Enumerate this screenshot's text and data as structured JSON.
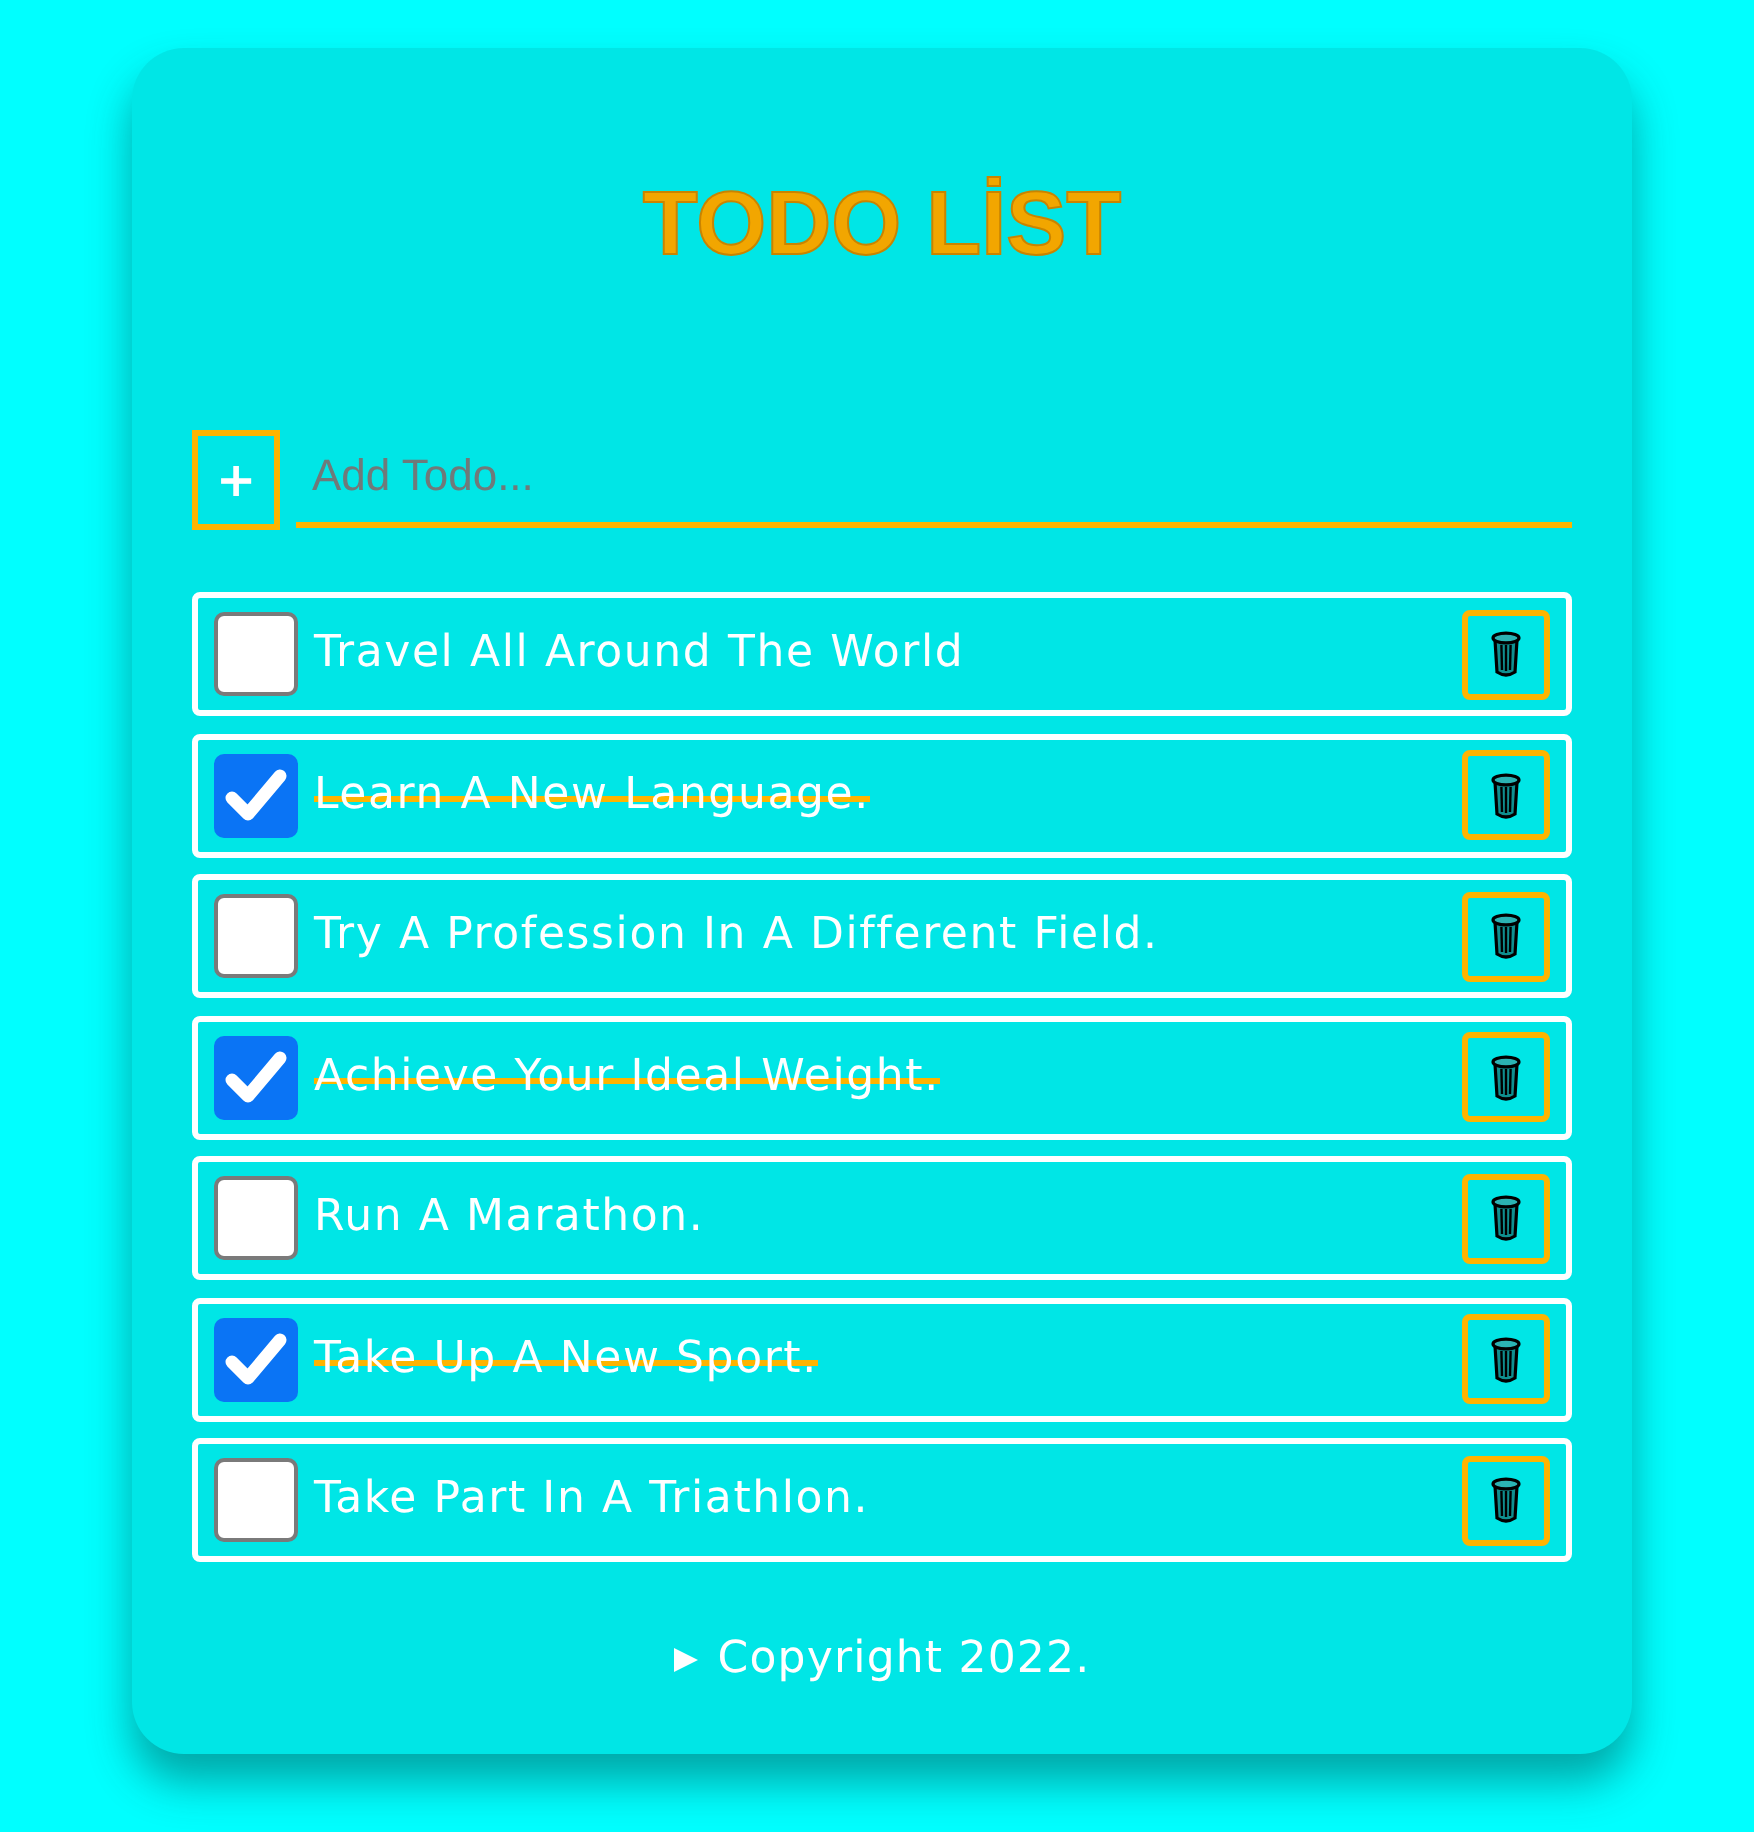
{
  "title": "TODO LİST",
  "add_form": {
    "button": "+",
    "input": {
      "placeholder": "Add Todo..."
    }
  },
  "todos": [
    {
      "text": "Travel All Around The World",
      "checked": false
    },
    {
      "text": "Learn A New Language.",
      "checked": true
    },
    {
      "text": "Try A Profession In A Different Field.",
      "checked": false
    },
    {
      "text": "Achieve Your Ideal Weight.",
      "checked": true
    },
    {
      "text": "Run A Marathon.",
      "checked": false
    },
    {
      "text": "Take Up A New Sport.",
      "checked": true
    },
    {
      "text": "Take Part In A Triathlon.",
      "checked": false
    }
  ],
  "footer": {
    "expanded": false,
    "text": "Copyright 2022."
  }
}
